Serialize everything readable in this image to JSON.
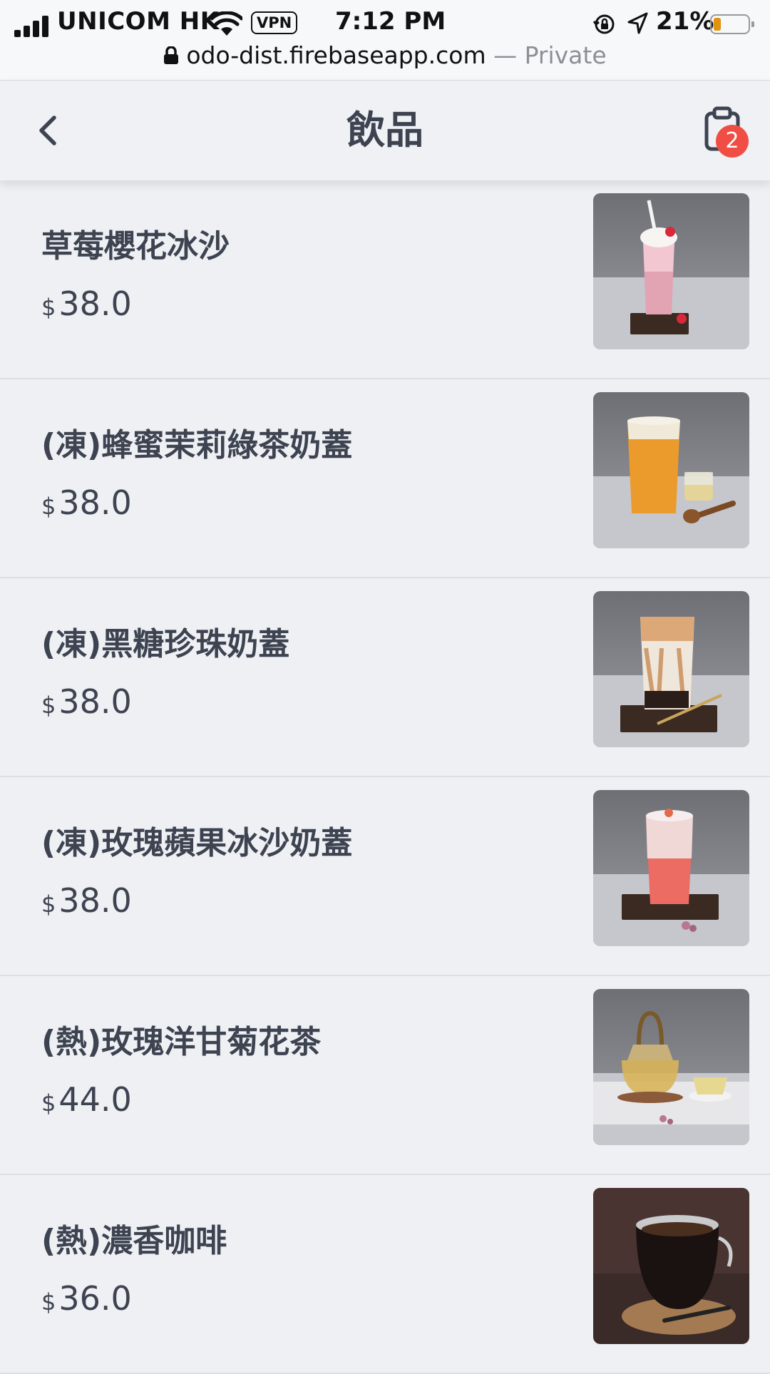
{
  "status_bar": {
    "carrier": "UNICOM HK",
    "vpn": "VPN",
    "time": "7:12 PM",
    "battery_pct": "21%",
    "battery_level": 0.21,
    "battery_color": "#e0930f"
  },
  "url_bar": {
    "host": "odo-dist.firebaseapp.com",
    "private": "— Private"
  },
  "header": {
    "title": "飲品",
    "back_icon": "chevron-left-icon",
    "cart_icon": "clipboard-cart-icon",
    "cart_count": "2",
    "badge_color": "#f04e45"
  },
  "products": [
    {
      "name": "草莓櫻花冰沙",
      "currency": "$",
      "price": "38.0",
      "image": "strawberry-sakura-smoothie"
    },
    {
      "name": "(凍)蜂蜜茉莉綠茶奶蓋",
      "currency": "$",
      "price": "38.0",
      "image": "honey-jasmine-green-tea"
    },
    {
      "name": "(凍)黑糖珍珠奶蓋",
      "currency": "$",
      "price": "38.0",
      "image": "brown-sugar-boba"
    },
    {
      "name": "(凍)玫瑰蘋果冰沙奶蓋",
      "currency": "$",
      "price": "38.0",
      "image": "rose-apple-smoothie"
    },
    {
      "name": "(熱)玫瑰洋甘菊花茶",
      "currency": "$",
      "price": "44.0",
      "image": "rose-chamomile-tea"
    },
    {
      "name": "(熱)濃香咖啡",
      "currency": "$",
      "price": "36.0",
      "image": "hot-coffee"
    }
  ]
}
